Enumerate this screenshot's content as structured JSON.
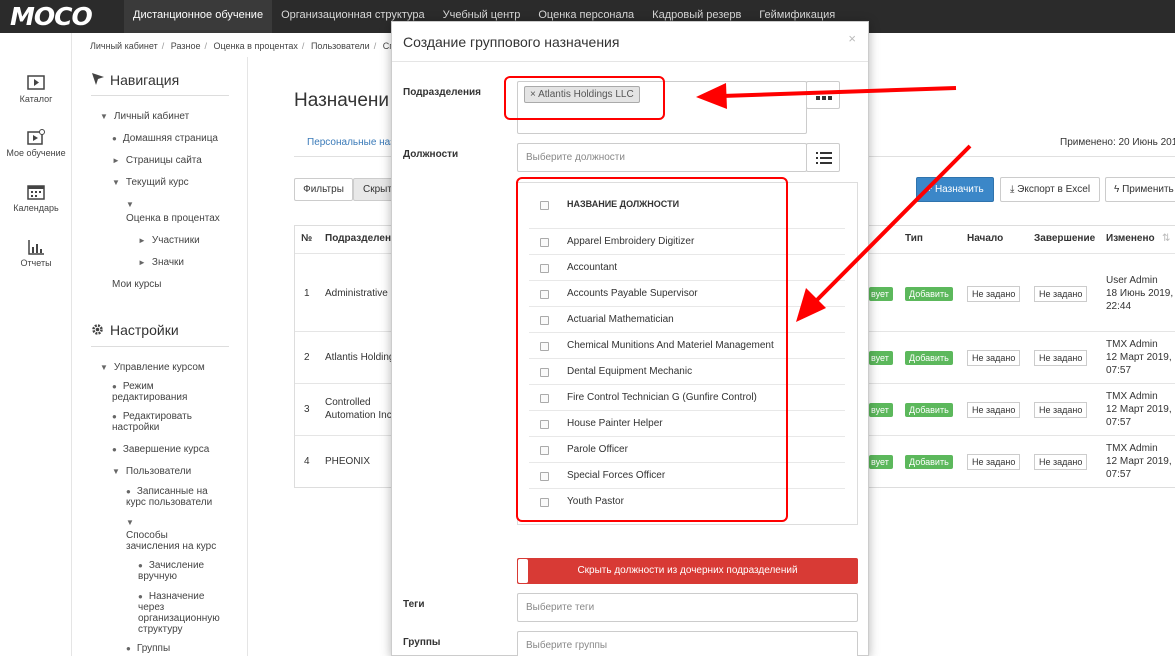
{
  "app": {
    "logo": "MOCO",
    "top_nav": [
      "Дистанционное обучение",
      "Организационная структура",
      "Учебный центр",
      "Оценка персонала",
      "Кадровый резерв",
      "Геймификация"
    ]
  },
  "rail": {
    "catalog": "Каталог",
    "my_learning": "Мое обучение",
    "calendar": "Календарь",
    "reports": "Отчеты"
  },
  "breadcrumb": [
    "Личный кабинет",
    "Разное",
    "Оценка в процентах",
    "Пользователи",
    "Спо"
  ],
  "sidebar": {
    "nav_title": "Навигация",
    "nav_items": [
      "Личный кабинет",
      "Домашняя страница",
      "Страницы сайта",
      "Текущий курс",
      "Оценка в процентах",
      "Участники",
      "Значки",
      "Мои курсы"
    ],
    "settings_title": "Настройки",
    "settings_items": [
      "Управление курсом",
      "Режим",
      "редактирования",
      "Редактировать",
      "настройки",
      "Завершение курса",
      "Пользователи",
      "Записанные на",
      "курс пользователи",
      "Способы",
      "зачисления на курс",
      "Зачисление",
      "вручную",
      "Назначение",
      "через",
      "организационную",
      "структуру",
      "Группы"
    ]
  },
  "page": {
    "title": "Назначени",
    "tab_personal": "Персональные наз",
    "applied": "Применено: 20 Июнь 2019",
    "filters": "Фильтры",
    "hide": "Скрыт",
    "assign": "Назначить",
    "export": "Экспорт в Excel",
    "apply": "Применить",
    "columns": [
      "№",
      "Подразделен",
      "Тип",
      "Начало",
      "Завершение",
      "Изменено"
    ],
    "rows": [
      {
        "num": "1",
        "dept": "Administrative C",
        "status": "вует",
        "type": "Добавить",
        "start": "Не задано",
        "end": "Не задано",
        "modified_by": "User Admin",
        "date": "18 Июнь 2019,",
        "time": "22:44"
      },
      {
        "num": "2",
        "dept": "Atlantis Holding",
        "status": "вует",
        "type": "Добавить",
        "start": "Не задано",
        "end": "Не задано",
        "modified_by": "TMX Admin",
        "date": "12 Март 2019,",
        "time": "07:57"
      },
      {
        "num": "3",
        "dept": "Controlled",
        "dept2": "Automation Inc",
        "status": "вует",
        "type": "Добавить",
        "start": "Не задано",
        "end": "Не задано",
        "modified_by": "TMX Admin",
        "date": "12 Март 2019,",
        "time": "07:57"
      },
      {
        "num": "4",
        "dept": "PHEONIX",
        "status": "вует",
        "type": "Добавить",
        "start": "Не задано",
        "end": "Не задано",
        "modified_by": "TMX Admin",
        "date": "12 Март 2019,",
        "time": "07:57"
      }
    ]
  },
  "modal": {
    "title": "Создание группового назначения",
    "close": "×",
    "departments_label": "Подразделения",
    "departments_tag": "Atlantis Holdings LLC",
    "departments_tag_remove": "×",
    "positions_label": "Должности",
    "positions_placeholder": "Выберите должности",
    "list_header": "НАЗВАНИЕ ДОЛЖНОСТИ",
    "positions": [
      "Apparel Embroidery Digitizer",
      "Accountant",
      "Accounts Payable Supervisor",
      "Actuarial Mathematician",
      "Chemical Munitions And Materiel Management",
      "Dental Equipment Mechanic",
      "Fire Control Technician G (Gunfire Control)",
      "House Painter Helper",
      "Parole Officer",
      "Special Forces Officer",
      "Youth Pastor"
    ],
    "hide_child_positions": "Скрыть должности из дочерних подразделений",
    "tags_label": "Теги",
    "tags_placeholder": "Выберите теги",
    "groups_label": "Группы",
    "groups_placeholder": "Выберите группы"
  },
  "colors": {
    "topbar": "#2b2b2b",
    "primary": "#3b87c8",
    "success": "#5cb85c",
    "danger": "#d83a35",
    "annotation": "#ff0000"
  }
}
